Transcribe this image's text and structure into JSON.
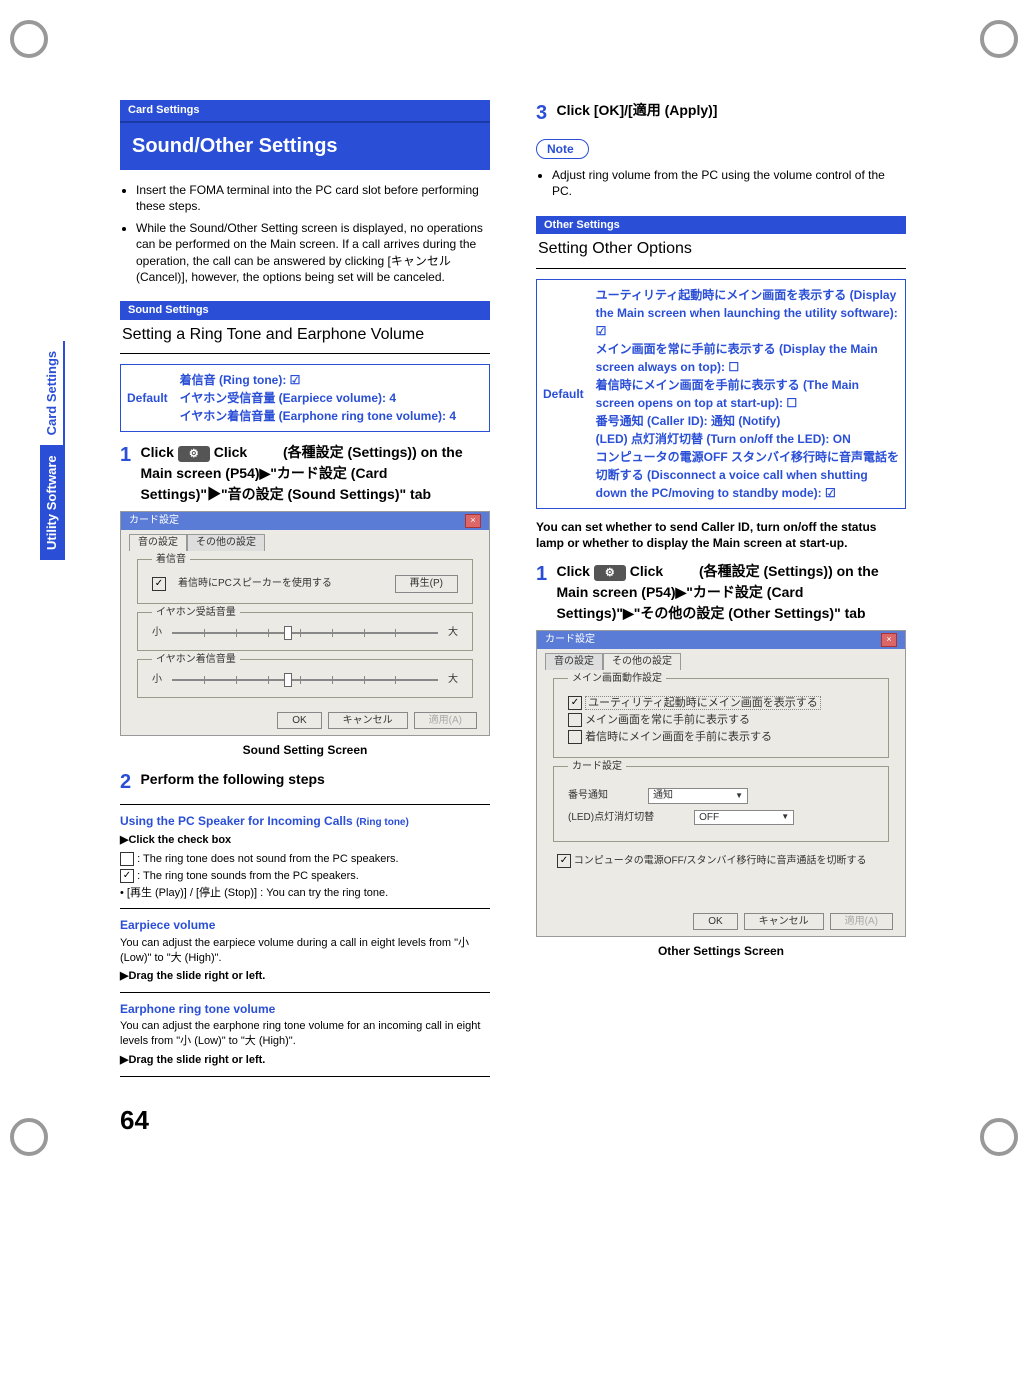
{
  "sideTabs": {
    "utility": "Utility Software",
    "card": "Card Settings"
  },
  "pageNumber": "64",
  "left": {
    "cardTag": "Card Settings",
    "heading": "Sound/Other Settings",
    "bullets": [
      "Insert the FOMA terminal into the PC card slot before performing these steps.",
      "While the Sound/Other Setting screen is displayed, no operations can be performed on the Main screen. If a call arrives during the operation, the call can be answered by clicking [キャンセル (Cancel)], however, the options being set will be canceled."
    ],
    "soundTag": "Sound Settings",
    "soundHeading": "Setting a Ring Tone and Earphone Volume",
    "defaultLabel": "Default",
    "defaultBody": "着信音 (Ring tone): ☑\nイヤホン受信音量 (Earpiece volume): 4\nイヤホン着信音量 (Earphone ring tone volume): 4",
    "step1": {
      "num": "1",
      "text": "Click 　　 (各種設定 (Settings)) on the Main screen (P54)▶\"カード設定 (Card Settings)\"▶\"音の設定 (Sound Settings)\" tab"
    },
    "screenshot1": {
      "title": "カード設定",
      "tab1": "音の設定",
      "tab2": "その他の設定",
      "group1": "着信音",
      "cbText": "着信時にPCスピーカーを使用する",
      "playBtn": "再生(P)",
      "group2": "イヤホン受話音量",
      "low": "小",
      "high": "大",
      "group3": "イヤホン着信音量",
      "ok": "OK",
      "cancel": "キャンセル",
      "apply": "適用(A)"
    },
    "caption1": "Sound Setting Screen",
    "step2": {
      "num": "2",
      "text": "Perform the following steps"
    },
    "pcSpeaker": {
      "title": "Using the PC Speaker for Incoming Calls",
      "titleSm": "(Ring tone)",
      "action": "▶Click the check box",
      "off": ": The ring tone does not sound from the PC speakers.",
      "on": ": The ring tone sounds from the PC speakers.",
      "play": "• [再生 (Play)] / [停止 (Stop)] : You can try the ring tone."
    },
    "earpiece": {
      "title": "Earpiece volume",
      "desc": "You can adjust the earpiece volume during a call in eight levels from \"小 (Low)\" to \"大 (High)\".",
      "action": "▶Drag the slide right or left."
    },
    "earphone": {
      "title": "Earphone ring tone volume",
      "desc": "You can adjust the earphone ring tone volume for an incoming call in eight levels from \"小 (Low)\" to \"大 (High)\".",
      "action": "▶Drag the slide right or left."
    }
  },
  "right": {
    "step3": {
      "num": "3",
      "text": "Click [OK]/[適用 (Apply)]"
    },
    "noteLabel": "Note",
    "noteText": "Adjust ring volume from the PC using the volume control of the PC.",
    "otherTag": "Other Settings",
    "otherHeading": "Setting Other Options",
    "defaultLabel": "Default",
    "defaultBody": "ユーティリティ起動時にメイン画面を表示する (Display the Main screen when launching the utility software): ☑\nメイン画面を常に手前に表示する (Display the Main screen always on top): ☐\n着信時にメイン画面を手前に表示する (The Main screen opens on top at start-up): ☐\n番号通知 (Caller ID): 通知 (Notify)\n(LED) 点灯消灯切替 (Turn on/off the LED): ON\nコンピュータの電源OFF スタンバイ移行時に音声電話を切断する (Disconnect a voice call when shutting down the PC/moving to standby mode): ☑",
    "intro": "You can set whether to send Caller ID, turn on/off the status lamp or whether to display the Main screen at start-up.",
    "step1": {
      "num": "1",
      "text": "Click 　　 (各種設定 (Settings)) on the Main screen (P54)▶\"カード設定 (Card Settings)\"▶\"その他の設定 (Other Settings)\" tab"
    },
    "screenshot2": {
      "title": "カード設定",
      "tab1": "音の設定",
      "tab2": "その他の設定",
      "group1": "メイン画面動作設定",
      "cb1": "ユーティリティ起動時にメイン画面を表示する",
      "cb2": "メイン画面を常に手前に表示する",
      "cb3": "着信時にメイン画面を手前に表示する",
      "group2": "カード設定",
      "field1": "番号通知",
      "val1": "通知",
      "field2": "(LED)点灯消灯切替",
      "val2": "OFF",
      "cb4": "コンピュータの電源OFF/スタンバイ移行時に音声通話を切断する",
      "ok": "OK",
      "cancel": "キャンセル",
      "apply": "適用(A)"
    },
    "caption2": "Other Settings Screen"
  }
}
